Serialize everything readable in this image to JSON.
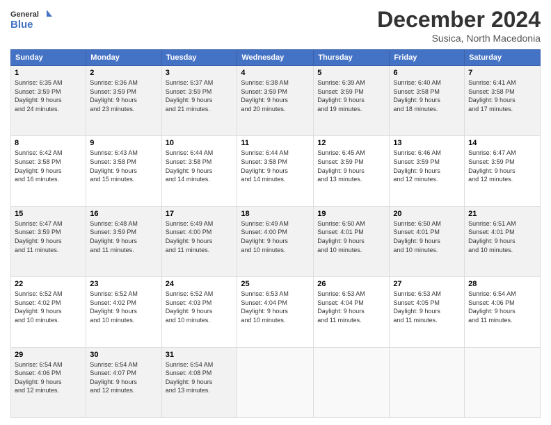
{
  "header": {
    "logo_line1": "General",
    "logo_line2": "Blue",
    "title": "December 2024",
    "subtitle": "Susica, North Macedonia"
  },
  "days_of_week": [
    "Sunday",
    "Monday",
    "Tuesday",
    "Wednesday",
    "Thursday",
    "Friday",
    "Saturday"
  ],
  "weeks": [
    [
      {
        "num": "1",
        "sunrise": "6:35 AM",
        "sunset": "3:59 PM",
        "daylight": "9 hours and 24 minutes."
      },
      {
        "num": "2",
        "sunrise": "6:36 AM",
        "sunset": "3:59 PM",
        "daylight": "9 hours and 23 minutes."
      },
      {
        "num": "3",
        "sunrise": "6:37 AM",
        "sunset": "3:59 PM",
        "daylight": "9 hours and 21 minutes."
      },
      {
        "num": "4",
        "sunrise": "6:38 AM",
        "sunset": "3:59 PM",
        "daylight": "9 hours and 20 minutes."
      },
      {
        "num": "5",
        "sunrise": "6:39 AM",
        "sunset": "3:59 PM",
        "daylight": "9 hours and 19 minutes."
      },
      {
        "num": "6",
        "sunrise": "6:40 AM",
        "sunset": "3:58 PM",
        "daylight": "9 hours and 18 minutes."
      },
      {
        "num": "7",
        "sunrise": "6:41 AM",
        "sunset": "3:58 PM",
        "daylight": "9 hours and 17 minutes."
      }
    ],
    [
      {
        "num": "8",
        "sunrise": "6:42 AM",
        "sunset": "3:58 PM",
        "daylight": "9 hours and 16 minutes."
      },
      {
        "num": "9",
        "sunrise": "6:43 AM",
        "sunset": "3:58 PM",
        "daylight": "9 hours and 15 minutes."
      },
      {
        "num": "10",
        "sunrise": "6:44 AM",
        "sunset": "3:58 PM",
        "daylight": "9 hours and 14 minutes."
      },
      {
        "num": "11",
        "sunrise": "6:44 AM",
        "sunset": "3:58 PM",
        "daylight": "9 hours and 14 minutes."
      },
      {
        "num": "12",
        "sunrise": "6:45 AM",
        "sunset": "3:59 PM",
        "daylight": "9 hours and 13 minutes."
      },
      {
        "num": "13",
        "sunrise": "6:46 AM",
        "sunset": "3:59 PM",
        "daylight": "9 hours and 12 minutes."
      },
      {
        "num": "14",
        "sunrise": "6:47 AM",
        "sunset": "3:59 PM",
        "daylight": "9 hours and 12 minutes."
      }
    ],
    [
      {
        "num": "15",
        "sunrise": "6:47 AM",
        "sunset": "3:59 PM",
        "daylight": "9 hours and 11 minutes."
      },
      {
        "num": "16",
        "sunrise": "6:48 AM",
        "sunset": "3:59 PM",
        "daylight": "9 hours and 11 minutes."
      },
      {
        "num": "17",
        "sunrise": "6:49 AM",
        "sunset": "4:00 PM",
        "daylight": "9 hours and 11 minutes."
      },
      {
        "num": "18",
        "sunrise": "6:49 AM",
        "sunset": "4:00 PM",
        "daylight": "9 hours and 10 minutes."
      },
      {
        "num": "19",
        "sunrise": "6:50 AM",
        "sunset": "4:01 PM",
        "daylight": "9 hours and 10 minutes."
      },
      {
        "num": "20",
        "sunrise": "6:50 AM",
        "sunset": "4:01 PM",
        "daylight": "9 hours and 10 minutes."
      },
      {
        "num": "21",
        "sunrise": "6:51 AM",
        "sunset": "4:01 PM",
        "daylight": "9 hours and 10 minutes."
      }
    ],
    [
      {
        "num": "22",
        "sunrise": "6:52 AM",
        "sunset": "4:02 PM",
        "daylight": "9 hours and 10 minutes."
      },
      {
        "num": "23",
        "sunrise": "6:52 AM",
        "sunset": "4:02 PM",
        "daylight": "9 hours and 10 minutes."
      },
      {
        "num": "24",
        "sunrise": "6:52 AM",
        "sunset": "4:03 PM",
        "daylight": "9 hours and 10 minutes."
      },
      {
        "num": "25",
        "sunrise": "6:53 AM",
        "sunset": "4:04 PM",
        "daylight": "9 hours and 10 minutes."
      },
      {
        "num": "26",
        "sunrise": "6:53 AM",
        "sunset": "4:04 PM",
        "daylight": "9 hours and 11 minutes."
      },
      {
        "num": "27",
        "sunrise": "6:53 AM",
        "sunset": "4:05 PM",
        "daylight": "9 hours and 11 minutes."
      },
      {
        "num": "28",
        "sunrise": "6:54 AM",
        "sunset": "4:06 PM",
        "daylight": "9 hours and 11 minutes."
      }
    ],
    [
      {
        "num": "29",
        "sunrise": "6:54 AM",
        "sunset": "4:06 PM",
        "daylight": "9 hours and 12 minutes."
      },
      {
        "num": "30",
        "sunrise": "6:54 AM",
        "sunset": "4:07 PM",
        "daylight": "9 hours and 12 minutes."
      },
      {
        "num": "31",
        "sunrise": "6:54 AM",
        "sunset": "4:08 PM",
        "daylight": "9 hours and 13 minutes."
      },
      null,
      null,
      null,
      null
    ]
  ],
  "labels": {
    "sunrise": "Sunrise:",
    "sunset": "Sunset:",
    "daylight": "Daylight:"
  }
}
